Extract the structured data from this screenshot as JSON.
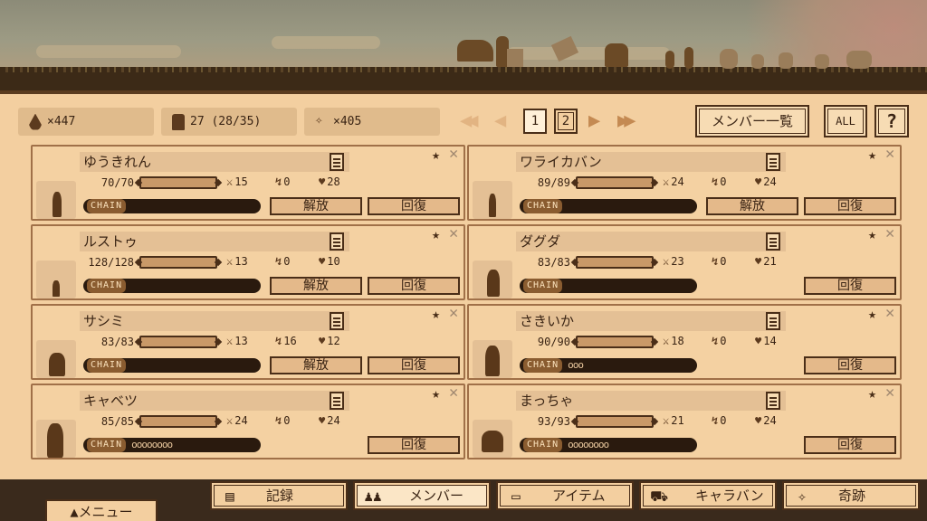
{
  "stats": {
    "water": "×447",
    "members": "27 (28/35)",
    "sparkle": "×405"
  },
  "pager": {
    "pages": [
      "1",
      "2"
    ],
    "current": "1"
  },
  "buttons": {
    "member_list": "メンバー一覧",
    "all": "ALL",
    "help": "?"
  },
  "labels": {
    "chain": "CHAIN",
    "release": "解放",
    "recover": "回復"
  },
  "members": [
    {
      "name": "ゆうきれん",
      "hp": "70/70",
      "atk": "15",
      "sta": "0",
      "def": "28",
      "chain": "",
      "release": true
    },
    {
      "name": "ワライカバン",
      "hp": "89/89",
      "atk": "24",
      "sta": "0",
      "def": "24",
      "chain": "",
      "release": true
    },
    {
      "name": "ルストゥ",
      "hp": "128/128",
      "atk": "13",
      "sta": "0",
      "def": "10",
      "chain": "",
      "release": true
    },
    {
      "name": "ダグダ",
      "hp": "83/83",
      "atk": "23",
      "sta": "0",
      "def": "21",
      "chain": "",
      "release": false
    },
    {
      "name": "サシミ",
      "hp": "83/83",
      "atk": "13",
      "sta": "16",
      "def": "12",
      "chain": "",
      "release": true
    },
    {
      "name": "さきいか",
      "hp": "90/90",
      "atk": "18",
      "sta": "0",
      "def": "14",
      "chain": "ooo",
      "release": false
    },
    {
      "name": "キャベツ",
      "hp": "85/85",
      "atk": "24",
      "sta": "0",
      "def": "24",
      "chain": "oooooooo",
      "release": false
    },
    {
      "name": "まっちゃ",
      "hp": "93/93",
      "atk": "21",
      "sta": "0",
      "def": "24",
      "chain": "oooooooo",
      "release": false
    }
  ],
  "tabs": [
    {
      "label": "記録",
      "icon": "record-icon"
    },
    {
      "label": "メンバー",
      "icon": "members-icon"
    },
    {
      "label": "アイテム",
      "icon": "item-icon"
    },
    {
      "label": "キャラバン",
      "icon": "caravan-icon"
    },
    {
      "label": "奇跡",
      "icon": "miracle-icon"
    }
  ],
  "menu": "▲メニュー"
}
